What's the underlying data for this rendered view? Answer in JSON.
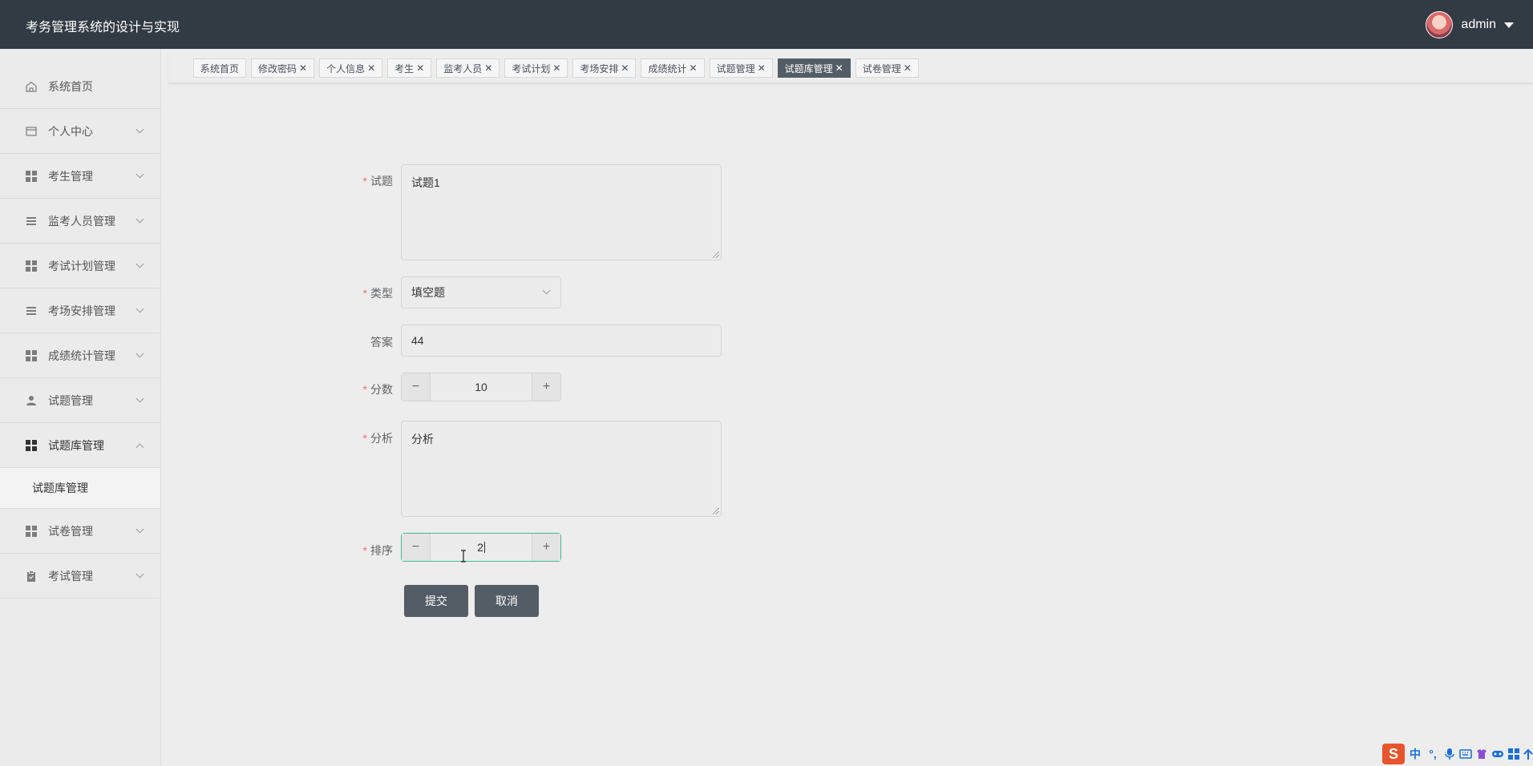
{
  "header": {
    "title": "考务管理系统的设计与实现",
    "username": "admin"
  },
  "sidebar": {
    "items": [
      {
        "label": "系统首页",
        "icon": "home-icon"
      },
      {
        "label": "个人中心",
        "icon": "card-icon"
      },
      {
        "label": "考生管理",
        "icon": "grid-icon"
      },
      {
        "label": "监考人员管理",
        "icon": "list-icon"
      },
      {
        "label": "考试计划管理",
        "icon": "grid-icon"
      },
      {
        "label": "考场安排管理",
        "icon": "list-icon"
      },
      {
        "label": "成绩统计管理",
        "icon": "grid-icon"
      },
      {
        "label": "试题管理",
        "icon": "user-icon"
      },
      {
        "label": "试题库管理",
        "icon": "grid-icon",
        "expanded": true
      },
      {
        "label": "试卷管理",
        "icon": "grid-icon"
      },
      {
        "label": "考试管理",
        "icon": "clipboard-icon"
      }
    ],
    "submenu": {
      "label": "试题库管理"
    }
  },
  "tabs": [
    {
      "label": "系统首页"
    },
    {
      "label": "修改密码"
    },
    {
      "label": "个人信息"
    },
    {
      "label": "考生"
    },
    {
      "label": "监考人员"
    },
    {
      "label": "考试计划"
    },
    {
      "label": "考场安排"
    },
    {
      "label": "成绩统计"
    },
    {
      "label": "试题管理"
    },
    {
      "label": "试题库管理",
      "active": true
    },
    {
      "label": "试卷管理"
    }
  ],
  "form": {
    "question": {
      "label": "试题",
      "value": "试题1"
    },
    "type": {
      "label": "类型",
      "value": "填空题"
    },
    "answer": {
      "label": "答案",
      "value": "44"
    },
    "score": {
      "label": "分数",
      "value": "10"
    },
    "analysis": {
      "label": "分析",
      "value": "分析"
    },
    "order": {
      "label": "排序",
      "value": "2"
    },
    "submit_label": "提交",
    "cancel_label": "取消"
  },
  "ime": {
    "logo": "S",
    "mode": "中",
    "punct": "°,"
  }
}
